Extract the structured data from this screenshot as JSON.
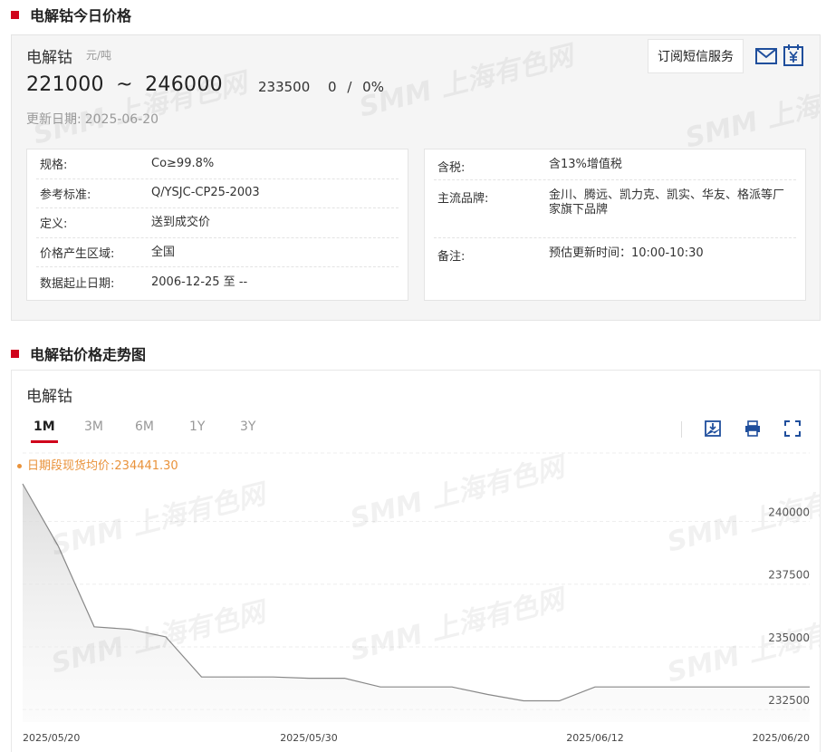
{
  "section1": {
    "title": "电解钴今日价格"
  },
  "price": {
    "product": "电解钴",
    "unit": "元/吨",
    "low": "221000",
    "high": "246000",
    "range_sep": "~",
    "avg": "233500",
    "change": "0",
    "change_pct": "0%",
    "change_sep": "/",
    "update_label": "更新日期:",
    "update_date": "2025-06-20",
    "subscribe_label": "订阅短信服务"
  },
  "watermark": {
    "text": "SMM 上海有色网"
  },
  "info_left": [
    {
      "k": "规格:",
      "v": "Co≥99.8%"
    },
    {
      "k": "参考标准:",
      "v": "Q/YSJC-CP25-2003"
    },
    {
      "k": "定义:",
      "v": "送到成交价"
    },
    {
      "k": "价格产生区域:",
      "v": "全国"
    },
    {
      "k": "数据起止日期:",
      "v": "2006-12-25 至 --"
    }
  ],
  "info_right": [
    {
      "k": "含税:",
      "v": "含13%增值税"
    },
    {
      "k": "主流品牌:",
      "v": "金川、腾远、凯力克、凯实、华友、格派等厂家旗下品牌"
    },
    {
      "k": "备注:",
      "v": "预估更新时间：10:00-10:30"
    }
  ],
  "section2": {
    "title": "电解钴价格走势图"
  },
  "chart": {
    "title": "电解钴",
    "tabs": [
      "1M",
      "3M",
      "6M",
      "1Y",
      "3Y"
    ],
    "active_tab": "1M",
    "avg_label": "日期段现货均价",
    "avg_sep": ":",
    "avg_value": "234441.30"
  },
  "colors": {
    "accent": "#d0021b",
    "legend": "#e9923a",
    "line": "#888888"
  },
  "icons": [
    "mail-icon",
    "yuan-icon",
    "download-image-icon",
    "print-icon",
    "fullscreen-icon"
  ],
  "chart_data": {
    "type": "area",
    "x": [
      "2025/05/20",
      "2025/05/21",
      "2025/05/22",
      "2025/05/23",
      "2025/05/26",
      "2025/05/27",
      "2025/05/28",
      "2025/05/29",
      "2025/05/30",
      "2025/06/03",
      "2025/06/04",
      "2025/06/05",
      "2025/06/06",
      "2025/06/09",
      "2025/06/10",
      "2025/06/11",
      "2025/06/12",
      "2025/06/13",
      "2025/06/16",
      "2025/06/17",
      "2025/06/18",
      "2025/06/19",
      "2025/06/20"
    ],
    "series": [
      {
        "values": [
          241500,
          239000,
          235800,
          235700,
          235400,
          233800,
          233800,
          233800,
          233750,
          233750,
          233400,
          233400,
          233400,
          233100,
          232850,
          232850,
          233400,
          233400,
          233400,
          233400,
          233400,
          233400,
          233400
        ]
      }
    ],
    "xticks": [
      "2025/05/20",
      "2025/05/30",
      "2025/06/12",
      "2025/06/20"
    ],
    "yticks": [
      232500,
      235000,
      237500,
      240000
    ],
    "ylim": [
      232000,
      241500
    ],
    "grid": true,
    "axis_side": "right"
  }
}
